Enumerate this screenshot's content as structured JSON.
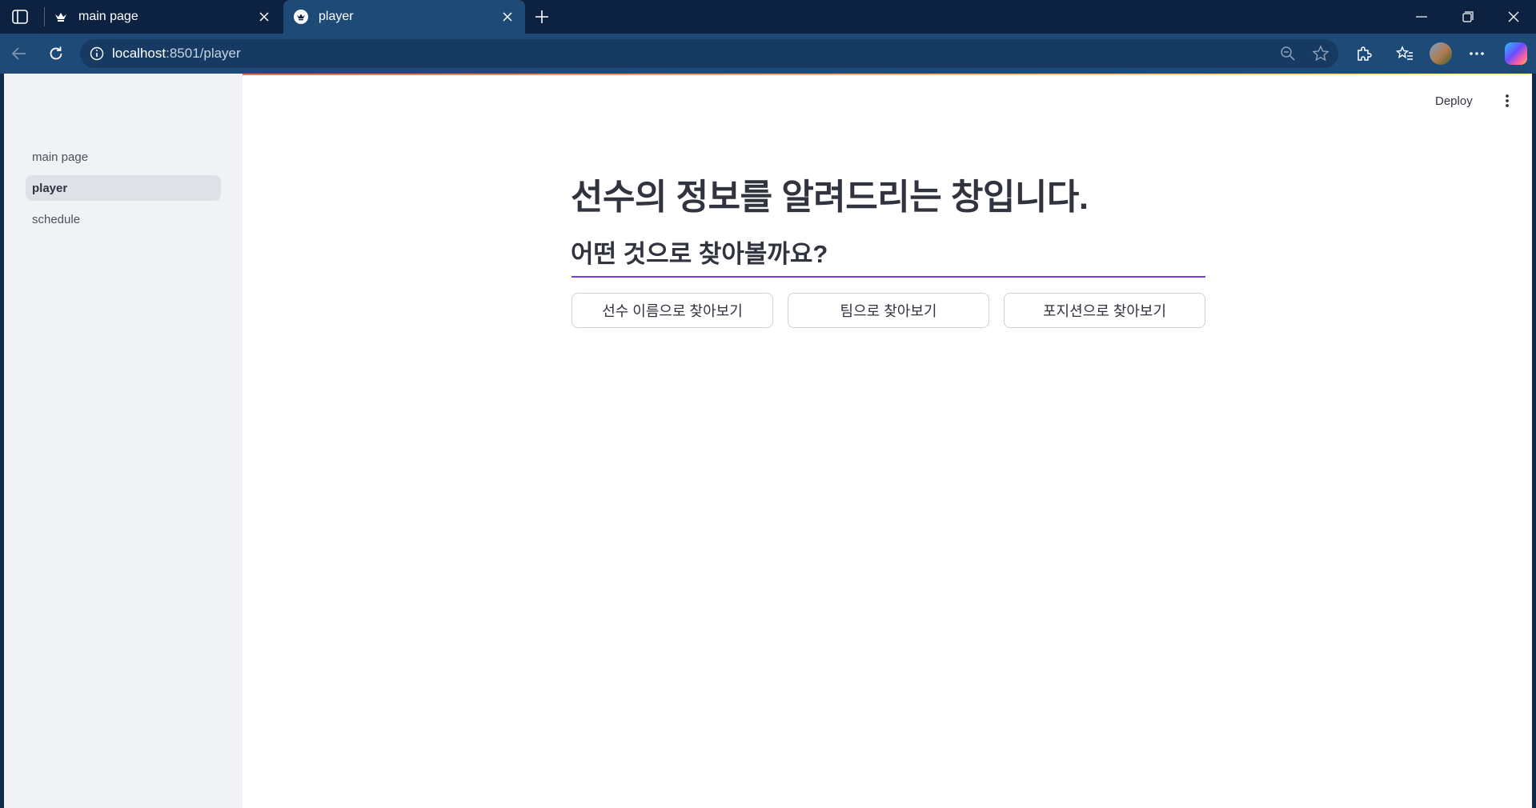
{
  "browser": {
    "tabs": [
      {
        "title": "main page",
        "active": false,
        "favicon": "crown-icon"
      },
      {
        "title": "player",
        "active": true,
        "favicon": "crown-icon"
      }
    ],
    "url": {
      "host": "localhost",
      "rest": ":8501/player"
    }
  },
  "app": {
    "sidebar": {
      "items": [
        {
          "label": "main page",
          "active": false
        },
        {
          "label": "player",
          "active": true
        },
        {
          "label": "schedule",
          "active": false
        }
      ]
    },
    "header": {
      "deploy_label": "Deploy"
    },
    "main": {
      "title": "선수의 정보를 알려드리는 창입니다.",
      "subtitle": "어떤 것으로 찾아볼까요?",
      "divider_color": "#7c3aed",
      "buttons": [
        {
          "label": "선수 이름으로 찾아보기"
        },
        {
          "label": "팀으로 찾아보기"
        },
        {
          "label": "포지션으로 찾아보기"
        }
      ]
    }
  }
}
